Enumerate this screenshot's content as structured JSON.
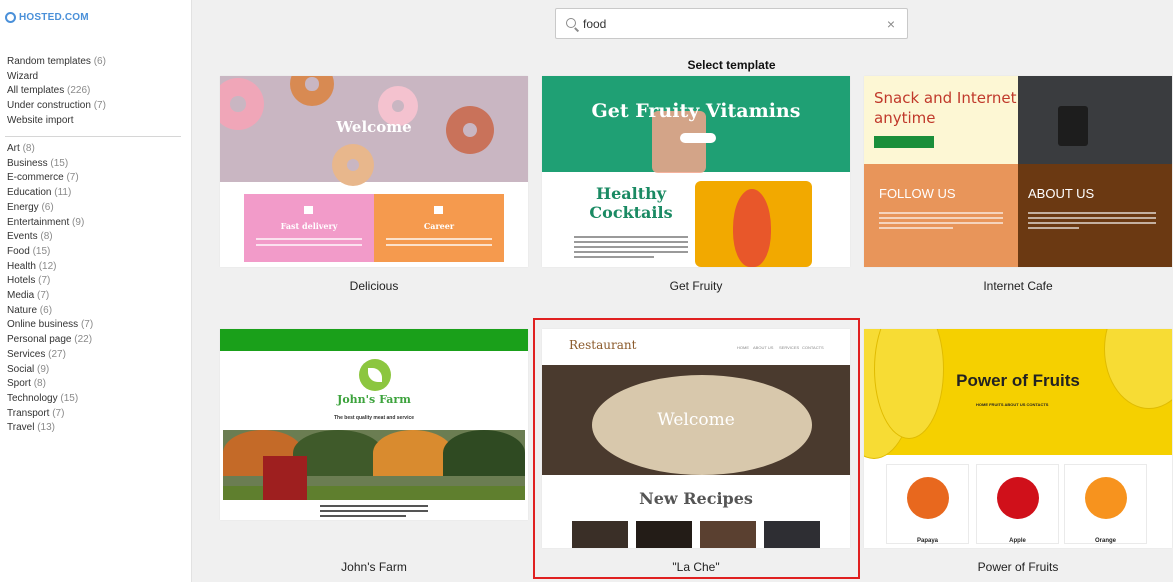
{
  "logo": {
    "text": "HOSTED.COM",
    "icon": "hosted-logo-icon",
    "color": "#4a90d9"
  },
  "sidebar": {
    "menu_primary": [
      {
        "label": "Random templates",
        "count": "(6)"
      },
      {
        "label": "Wizard",
        "count": ""
      },
      {
        "label": "All templates",
        "count": "(226)"
      },
      {
        "label": "Under construction",
        "count": "(7)"
      },
      {
        "label": "Website import",
        "count": ""
      }
    ],
    "categories": [
      {
        "label": "Art",
        "count": "(8)"
      },
      {
        "label": "Business",
        "count": "(15)"
      },
      {
        "label": "E-commerce",
        "count": "(7)"
      },
      {
        "label": "Education",
        "count": "(11)"
      },
      {
        "label": "Energy",
        "count": "(6)"
      },
      {
        "label": "Entertainment",
        "count": "(9)"
      },
      {
        "label": "Events",
        "count": "(8)"
      },
      {
        "label": "Food",
        "count": "(15)"
      },
      {
        "label": "Health",
        "count": "(12)"
      },
      {
        "label": "Hotels",
        "count": "(7)"
      },
      {
        "label": "Media",
        "count": "(7)"
      },
      {
        "label": "Nature",
        "count": "(6)"
      },
      {
        "label": "Online business",
        "count": "(7)"
      },
      {
        "label": "Personal page",
        "count": "(22)"
      },
      {
        "label": "Services",
        "count": "(27)"
      },
      {
        "label": "Social",
        "count": "(9)"
      },
      {
        "label": "Sport",
        "count": "(8)"
      },
      {
        "label": "Technology",
        "count": "(15)"
      },
      {
        "label": "Transport",
        "count": "(7)"
      },
      {
        "label": "Travel",
        "count": "(13)"
      }
    ]
  },
  "search": {
    "value": "food",
    "icon": "search-icon",
    "clear_icon": "close-icon",
    "clear_glyph": "×"
  },
  "heading": "Select template",
  "templates": {
    "delicious": {
      "name": "Delicious",
      "preview": {
        "welcome": "Welcome",
        "box1": "Fast delivery",
        "box2": "Career"
      }
    },
    "get_fruity": {
      "name": "Get Fruity",
      "preview": {
        "title": "Get Fruity Vitamins",
        "title2a": "Healthy",
        "title2b": "Cocktails"
      }
    },
    "internet_cafe": {
      "name": "Internet Cafe",
      "preview": {
        "title_line1": "Snack and Internet",
        "title_line2": "anytime",
        "follow": "FOLLOW US",
        "about": "ABOUT US"
      }
    },
    "johns_farm": {
      "name": "John's Farm",
      "preview": {
        "title": "John's Farm",
        "subtitle": "The best quality meat and service"
      }
    },
    "la_che": {
      "name": "\"La Che\"",
      "selected": true,
      "preview": {
        "logo": "Restaurant",
        "nav": [
          "HOME",
          "ABOUT US",
          "SERVICES",
          "CONTACTS"
        ],
        "welcome": "Welcome",
        "section": "New Recipes"
      }
    },
    "power_of_fruits": {
      "name": "Power of Fruits",
      "preview": {
        "title": "Power of Fruits",
        "nav": "HOME   FRUITS   ABOUT US   CONTACTS",
        "items": [
          "Papaya",
          "Apple",
          "Orange"
        ]
      }
    }
  },
  "colors": {
    "selected_border": "#e02020",
    "farm_green": "#1aa01a",
    "fruity_green": "#1fa074",
    "fruits_yellow": "#f5d000"
  }
}
